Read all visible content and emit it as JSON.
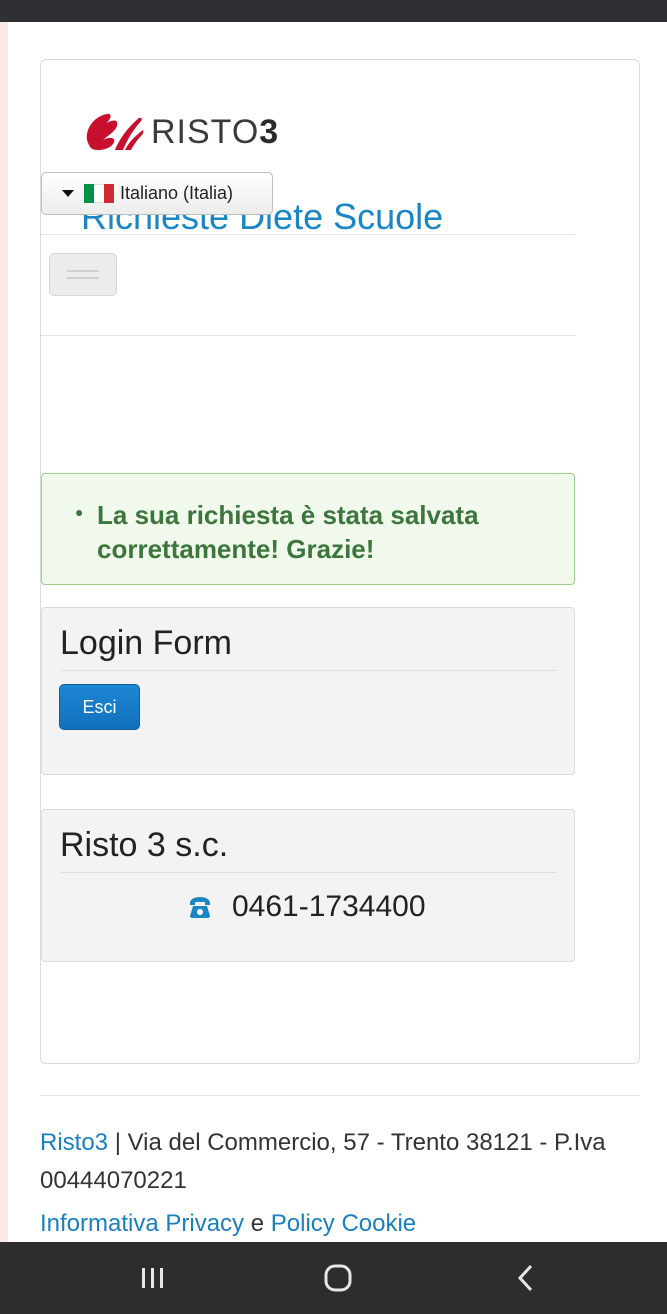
{
  "brand": {
    "logo_text": "RISTO",
    "logo_num": "3",
    "site_title": "Richieste Diete Scuole",
    "logo_color": "#c8102e"
  },
  "language": {
    "selected": "Italiano (Italia)",
    "flag_colors": [
      "#009246",
      "#ffffff",
      "#ce2b37"
    ]
  },
  "alert": {
    "message": "La sua richiesta è stata salvata correttamente! Grazie!"
  },
  "login": {
    "title": "Login Form",
    "logout_label": "Esci"
  },
  "contact": {
    "title": "Risto 3 s.c.",
    "phone": "0461-1734400",
    "icon": "phone-icon"
  },
  "footer": {
    "brand_link": "Risto3",
    "address": " | Via del Commercio, 57 - Trento 38121 - P.Iva 00444070221",
    "privacy_link": "Informativa Privacy",
    "conjunction": " e ",
    "cookie_link": "Policy Cookie"
  },
  "colors": {
    "accent": "#1a86c3",
    "success_text": "#3c763d",
    "button_primary": "#1271bd"
  }
}
